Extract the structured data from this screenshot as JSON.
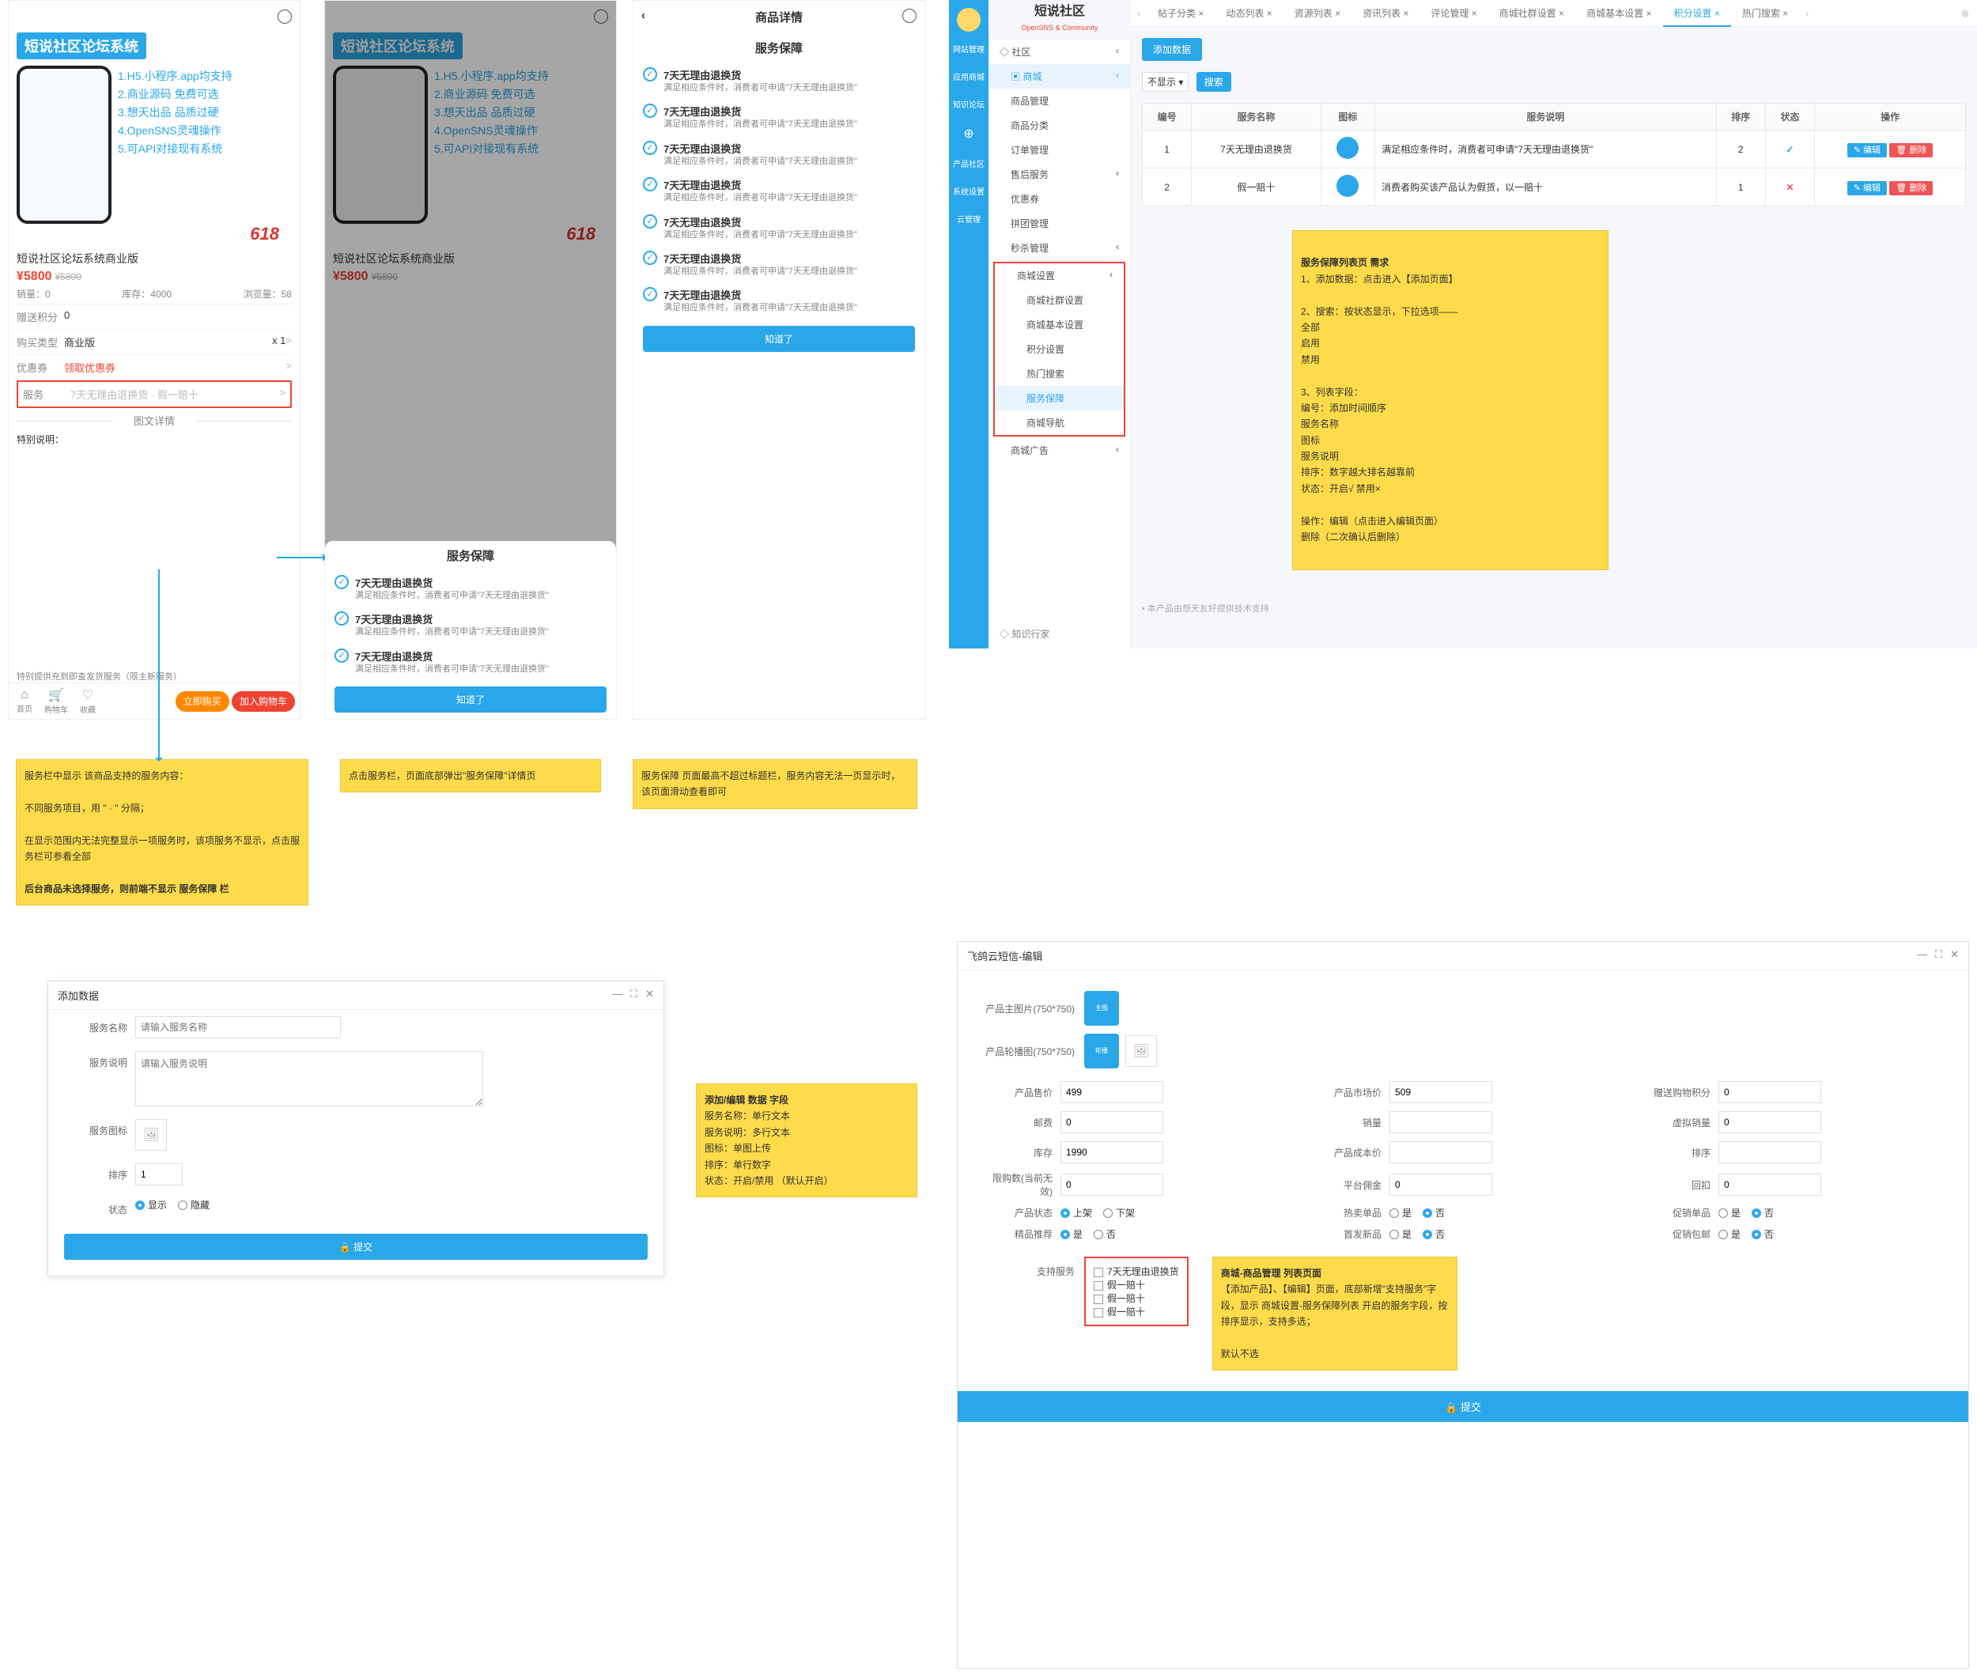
{
  "mobile": {
    "banner_title": "短说社区论坛系统",
    "features": [
      "1.H5.小程序.app均支持",
      "2.商业源码 免费可选",
      "3.想天出品 品质过硬",
      "4.OpenSNS灵魂操作",
      "5.可API对接现有系统"
    ],
    "ad618": "618",
    "product_name": "短说社区论坛系统商业版",
    "price": "¥5800",
    "price_old": "¥5800",
    "stats": {
      "sold_l": "销量：",
      "sold_v": "0",
      "stock_l": "库存：",
      "stock_v": "4000",
      "view_l": "浏览量：",
      "view_v": "58"
    },
    "rows": {
      "points": {
        "k": "赠送积分",
        "v": "0"
      },
      "type": {
        "k": "购买类型",
        "v": "商业版",
        "qty": "x 1",
        "chev": ">"
      },
      "coupon": {
        "k": "优惠券",
        "v": "领取优惠券",
        "chev": ">"
      },
      "service": {
        "k": "服务",
        "v": "7天无理由退换货 · 假一赔十",
        "chev": ">"
      }
    },
    "tab_detail": "图文详情",
    "special_note": "特别说明：",
    "provided_note": "特别提供充到即查发货服务（限主新服务）",
    "bottom": {
      "home": "首页",
      "cart": "购物车",
      "fav": "收藏",
      "buy_now": "立即购买",
      "add_cart": "加入购物车"
    }
  },
  "sheet": {
    "title": "服务保障",
    "item_title": "7天无理由退换货",
    "item_desc": "满足相应条件时，消费者可申请\"7天无理由退换货\"",
    "know": "知道了"
  },
  "detail_header": "商品详情",
  "note1": {
    "l1": "服务栏中显示 该商品支持的服务内容：",
    "l2": "不同服务项目，用 \" · \" 分隔；",
    "l3": "在显示范围内无法完整显示一项服务时，该项服务不显示，点击服务栏可参看全部",
    "l4": "后台商品未选择服务，则前端不显示 服务保障 栏"
  },
  "note2": "点击服务栏，页面底部弹出\"服务保障\"详情页",
  "note3": "服务保障 页面最高不超过标题栏，服务内容无法一页显示时，该页面滑动查看即可",
  "admin": {
    "brand_cn": "短说社区",
    "brand_en": "OpenSNS & Community",
    "side": [
      "网站管理",
      "应用商城",
      "知识论坛",
      "⊕",
      "产品社区",
      "系统设置",
      "云管理"
    ],
    "nav": {
      "community": "社区",
      "mall": "商城",
      "items": [
        "商品管理",
        "商品分类",
        "订单管理",
        "售后服务",
        "优惠券",
        "拼团管理",
        "秒杀管理"
      ],
      "settings": "商城设置",
      "settings_items": [
        "商城社群设置",
        "商城基本设置",
        "积分设置",
        "热门搜索",
        "服务保障",
        "商城导航"
      ],
      "ads": "商城广告",
      "footer": "知识行家"
    },
    "tabs": [
      "帖子分类",
      "动态列表",
      "资源列表",
      "资讯列表",
      "评论管理",
      "商城社群设置",
      "商城基本设置",
      "积分设置",
      "热门搜索"
    ],
    "active_tab": "积分设置",
    "btn_add": "添加数据",
    "filter_label": "不显示",
    "filter_btn": "搜索",
    "table": {
      "headers": [
        "编号",
        "服务名称",
        "图标",
        "服务说明",
        "排序",
        "状态",
        "操作"
      ],
      "rows": [
        {
          "id": "1",
          "name": "7天无理由退换货",
          "desc": "满足相应条件时，消费者可申请\"7天无理由退换货\"",
          "sort": "2",
          "status": "✓"
        },
        {
          "id": "2",
          "name": "假一赔十",
          "desc": "消费者购买该产品认为假货，以一赔十",
          "sort": "1",
          "status": "✕"
        }
      ],
      "op_edit": "编辑",
      "op_del": "删除"
    },
    "foot": "本产品由想天友好提供技术支持"
  },
  "note_admin": {
    "title": "服务保障列表页 需求",
    "l1": "1、添加数据：点击进入【添加页面】",
    "l2": "2、搜索：按状态显示，下拉选项——\n全部\n启用\n禁用",
    "l3": "3、列表字段：\n编号：添加时间顺序\n服务名称\n图标\n服务说明\n排序：数字越大排名越靠前\n状态：开启√   禁用×",
    "l4": "操作：编辑（点击进入编辑页面）\n           删除（二次确认后删除）"
  },
  "dlg": {
    "title": "添加数据",
    "fields": {
      "name": "服务名称",
      "name_ph": "请输入服务名称",
      "desc": "服务说明",
      "desc_ph": "请输入服务说明",
      "icon": "服务图标",
      "sort": "排序",
      "sort_v": "1",
      "status": "状态",
      "show": "显示",
      "hide": "隐藏"
    },
    "submit": "提交"
  },
  "note_dlg": {
    "title": "添加/编辑 数据 字段",
    "l1": "服务名称：单行文本",
    "l2": "服务说明：多行文本",
    "l3": "图标：单图上传",
    "l4": "排序：单行数字",
    "l5": "状态：开启/禁用 （默认开启）"
  },
  "editor": {
    "title": "飞鸽云短信-编辑",
    "main_img": "产品主图片(750*750)",
    "slide_img": "产品轮播图(750*750)",
    "fields": {
      "sale_price": {
        "l": "产品售价",
        "v": "499"
      },
      "market_price": {
        "l": "产品市场价",
        "v": "509"
      },
      "give_points": {
        "l": "赠送购物积分",
        "v": "0"
      },
      "post_fee": {
        "l": "邮费",
        "v": "0"
      },
      "sold": {
        "l": "销量",
        "v": ""
      },
      "virtual_sold": {
        "l": "虚拟销量",
        "v": "0"
      },
      "stock": {
        "l": "库存",
        "v": "1990"
      },
      "cost": {
        "l": "产品成本价",
        "v": ""
      },
      "sort": {
        "l": "排序",
        "v": ""
      },
      "limit": {
        "l": "限购数(当前无效)",
        "v": "0"
      },
      "commission": {
        "l": "平台佣金",
        "v": "0"
      },
      "rebate": {
        "l": "回扣",
        "v": "0"
      }
    },
    "radios": {
      "status": {
        "l": "产品状态",
        "a": "上架",
        "b": "下架"
      },
      "hot": {
        "l": "热卖单品",
        "a": "是",
        "b": "否"
      },
      "promo": {
        "l": "促销单品",
        "a": "是",
        "b": "否"
      },
      "rec": {
        "l": "精品推荐",
        "a": "是",
        "b": "否"
      },
      "new": {
        "l": "首发新品",
        "a": "是",
        "b": "否"
      },
      "free_ship": {
        "l": "促销包邮",
        "a": "是",
        "b": "否"
      }
    },
    "support": {
      "l": "支持服务",
      "opts": [
        "7天无理由退换货",
        "假一赔十",
        "假一赔十",
        "假一赔十"
      ]
    },
    "submit": "提交"
  },
  "note_editor": {
    "title": "商城-商品管理 列表页面",
    "l1": "【添加产品】、【编辑】页面，底部新增\"支持服务\"字段，显示 商城设置-服务保障列表 开启的服务字段，按排序显示，支持多选；",
    "l2": "默认不选"
  }
}
